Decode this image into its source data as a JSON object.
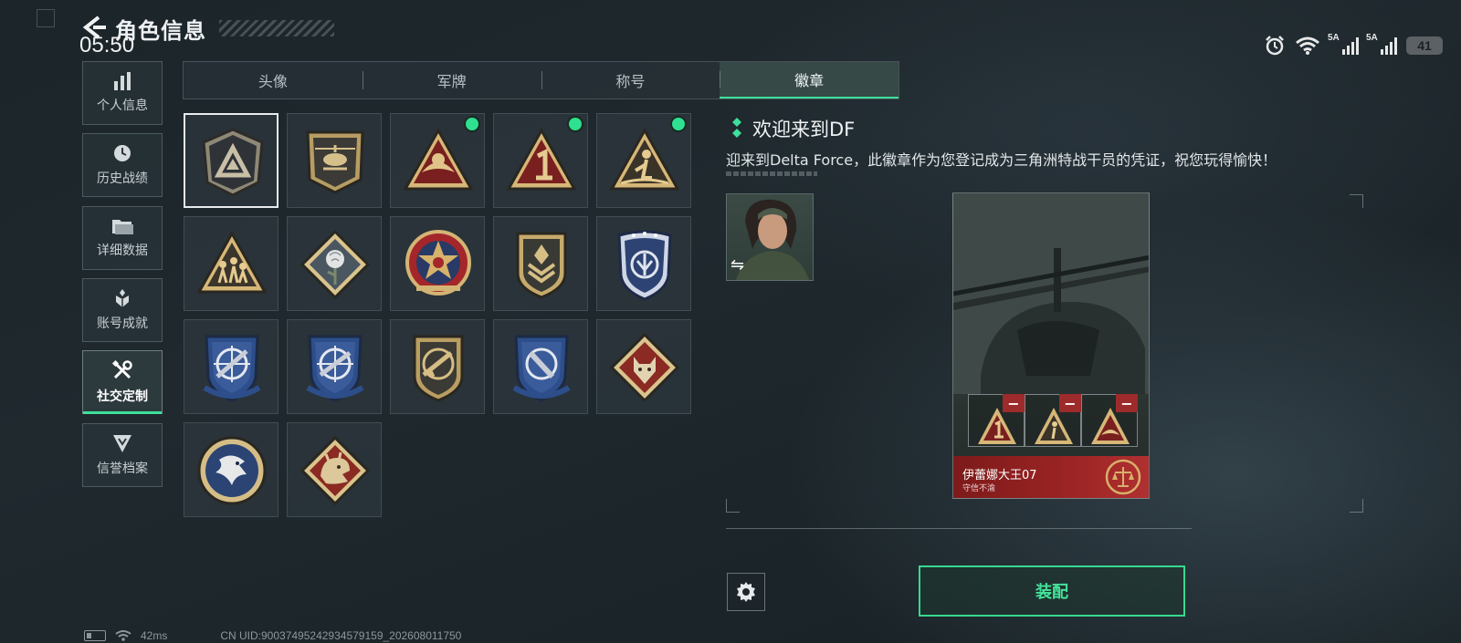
{
  "header": {
    "title": "角色信息",
    "clock": "05:50"
  },
  "status_bar": {
    "signal_1": "5A",
    "signal_2": "5A",
    "battery": "41"
  },
  "sidebar": {
    "items": [
      {
        "label": "个人信息",
        "icon": "bar-chart-icon"
      },
      {
        "label": "历史战绩",
        "icon": "clock-icon"
      },
      {
        "label": "详细数据",
        "icon": "folder-icon"
      },
      {
        "label": "账号成就",
        "icon": "achievement-icon"
      },
      {
        "label": "社交定制",
        "icon": "tools-icon",
        "active": true
      },
      {
        "label": "信誉档案",
        "icon": "emblem-icon"
      }
    ]
  },
  "tabs": [
    {
      "label": "头像"
    },
    {
      "label": "军牌"
    },
    {
      "label": "称号"
    },
    {
      "label": "徽章",
      "active": true
    }
  ],
  "badges": [
    {
      "name": "badge-delta-triangle",
      "selected": true,
      "new": false
    },
    {
      "name": "badge-helicopter",
      "new": false
    },
    {
      "name": "badge-wings-triangle",
      "new": true
    },
    {
      "name": "badge-number-one",
      "new": true
    },
    {
      "name": "badge-figure-triangle",
      "new": true
    },
    {
      "name": "badge-squad-triangle",
      "new": false
    },
    {
      "name": "badge-rose-diamond",
      "new": false
    },
    {
      "name": "badge-star-roundel",
      "new": false
    },
    {
      "name": "badge-chevron-shield",
      "new": false
    },
    {
      "name": "badge-blue-crest",
      "new": false
    },
    {
      "name": "badge-sniper-shield-1",
      "new": false
    },
    {
      "name": "badge-sniper-shield-2",
      "new": false
    },
    {
      "name": "badge-rifle-shield",
      "new": false
    },
    {
      "name": "badge-knife-shield",
      "new": false
    },
    {
      "name": "badge-wolf-diamond",
      "new": false
    },
    {
      "name": "badge-eagle-roundel",
      "new": false
    },
    {
      "name": "badge-dragon-diamond",
      "new": false
    }
  ],
  "detail": {
    "title": "欢迎来到DF",
    "description": "迎来到Delta Force，此徽章作为您登记成为三角洲特战干员的凭证，祝您玩得愉快！"
  },
  "card": {
    "player_name": "伊蕾娜大王07",
    "subtitle": "守信不渝"
  },
  "actions": {
    "equip_label": "装配"
  },
  "bottom_bar": {
    "ping": "42ms",
    "uid": "CN UID:9003749524293457915​9_202608011750"
  },
  "colors": {
    "accent": "#3ddf9a",
    "new_dot": "#2ee08f",
    "card_red": "#9c2424",
    "badge_gold": "#c9a560"
  }
}
